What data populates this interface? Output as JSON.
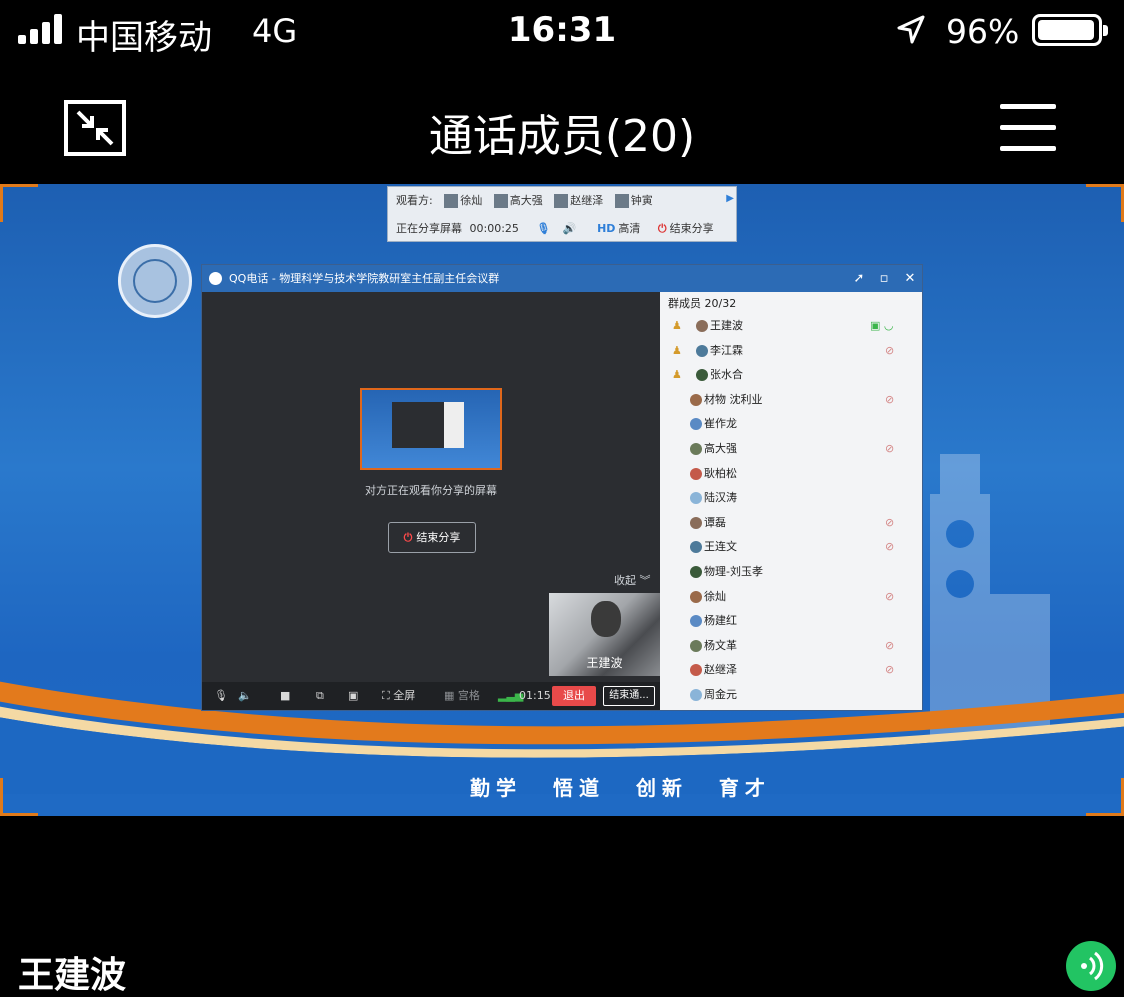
{
  "status_bar": {
    "carrier": "中国移动",
    "network": "4G",
    "time": "16:31",
    "battery": "96%",
    "battery_level": 0.96,
    "icons": [
      "signal-icon",
      "location-arrow-icon",
      "battery-icon"
    ]
  },
  "nav": {
    "title": "通话成员(20)",
    "icons": [
      "minimize-window-icon",
      "menu-icon"
    ]
  },
  "viewer_bar": {
    "viewers_label": "观看方:",
    "viewers": [
      "徐灿",
      "高大强",
      "赵继泽",
      "钟寅"
    ],
    "sharing_label": "正在分享屏幕",
    "sharing_time": "00:00:25",
    "quality": "高清",
    "end_share": "结束分享"
  },
  "qq_window": {
    "title": "QQ电话 - 物理科学与技术学院教研室主任副主任会议群",
    "share_caption": "对方正在观看你分享的屏幕",
    "end_share_button": "结束分享",
    "collapse": "收起",
    "self_name": "王建波",
    "controls": {
      "fullscreen": "全屏",
      "grid": "宫格",
      "duration": "01:15",
      "exit": "退出",
      "end_call": "结束通..."
    },
    "members_header": "群成员 20/32",
    "members": [
      {
        "name": "王建波",
        "admin": true,
        "mic": "on"
      },
      {
        "name": "李江霖",
        "admin": true,
        "mic": "muted"
      },
      {
        "name": "张水合",
        "admin": true,
        "mic": "none"
      },
      {
        "name": "材物 沈利业",
        "admin": false,
        "mic": "muted"
      },
      {
        "name": "崔作龙",
        "admin": false,
        "mic": "none"
      },
      {
        "name": "高大强",
        "admin": false,
        "mic": "muted"
      },
      {
        "name": "耿柏松",
        "admin": false,
        "mic": "none"
      },
      {
        "name": "陆汉涛",
        "admin": false,
        "mic": "none"
      },
      {
        "name": "谭磊",
        "admin": false,
        "mic": "muted"
      },
      {
        "name": "王连文",
        "admin": false,
        "mic": "muted"
      },
      {
        "name": "物理-刘玉孝",
        "admin": false,
        "mic": "none"
      },
      {
        "name": "徐灿",
        "admin": false,
        "mic": "muted"
      },
      {
        "name": "杨建红",
        "admin": false,
        "mic": "none"
      },
      {
        "name": "杨文革",
        "admin": false,
        "mic": "muted"
      },
      {
        "name": "赵继泽",
        "admin": false,
        "mic": "muted"
      },
      {
        "name": "周金元",
        "admin": false,
        "mic": "none"
      }
    ]
  },
  "motto": [
    "勤学",
    "悟道",
    "创新",
    "育才"
  ],
  "caller_name": "王建波",
  "colors": {
    "background": "#000000",
    "speaker_button": "#22c463",
    "screen_blue": "#2a79cc",
    "accent_orange": "#e07a1a"
  }
}
